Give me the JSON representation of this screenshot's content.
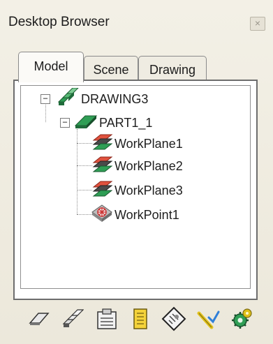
{
  "window": {
    "title": "Desktop Browser",
    "close_glyph": "×"
  },
  "tabs": [
    {
      "label": "Model",
      "active": true
    },
    {
      "label": "Scene",
      "active": false
    },
    {
      "label": "Drawing",
      "active": false
    }
  ],
  "tree": {
    "collapse_glyph": "−",
    "root": {
      "label": "DRAWING3",
      "icon": "drawing-icon",
      "expanded": true
    },
    "part": {
      "label": "PART1_1",
      "icon": "part-icon",
      "expanded": true
    },
    "children": [
      {
        "label": "WorkPlane1",
        "icon": "workplane-icon"
      },
      {
        "label": "WorkPlane2",
        "icon": "workplane-icon"
      },
      {
        "label": "WorkPlane3",
        "icon": "workplane-icon"
      },
      {
        "label": "WorkPoint1",
        "icon": "workpoint-icon"
      }
    ]
  },
  "toolbar": {
    "icons": [
      "part-tool-icon",
      "assembly-tool-icon",
      "clipboard-tool-icon",
      "list-tool-icon",
      "diamond-tool-icon",
      "check-tool-icon",
      "gear-tool-icon"
    ]
  },
  "colors": {
    "accent_green": "#2f9e55",
    "workplane_red": "#d23a2a",
    "workpoint_gray": "#6b6b6b"
  }
}
